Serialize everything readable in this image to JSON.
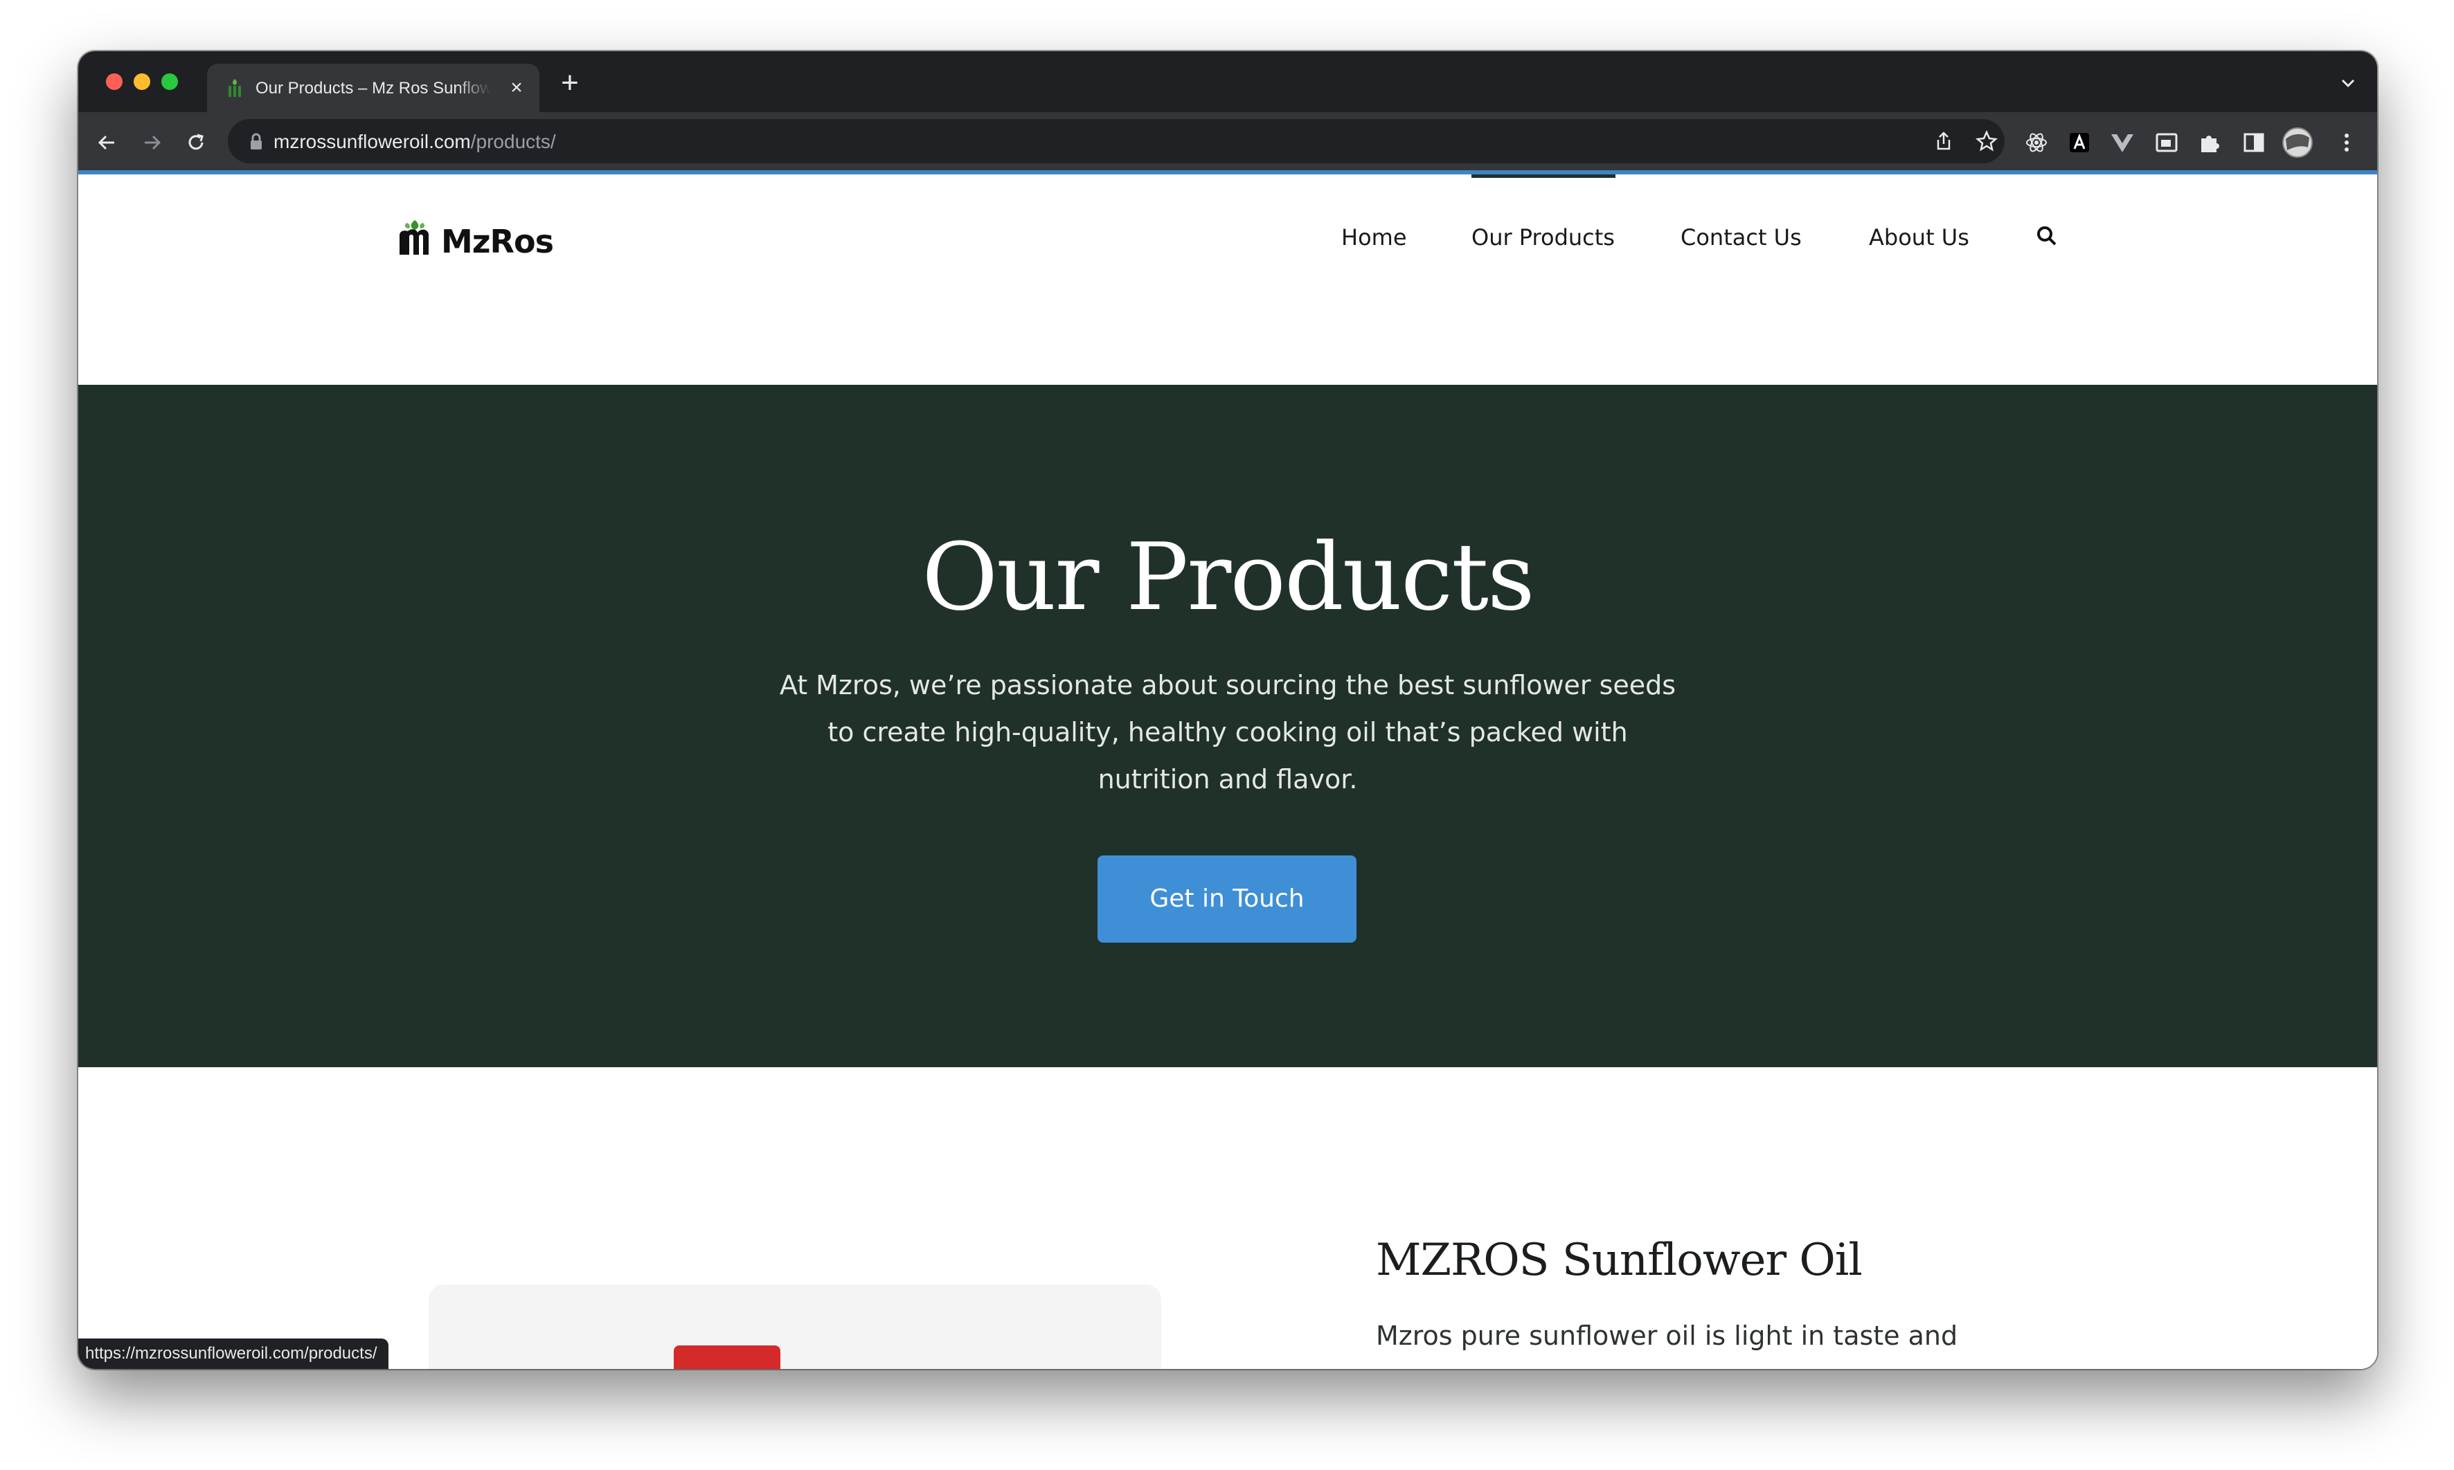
{
  "browser": {
    "tab_title": "Our Products – Mz Ros Sunflower Oil",
    "url_host": "mzrossunfloweroil.com",
    "url_path": "/products/",
    "status_url": "https://mzrossunfloweroil.com/products/"
  },
  "site": {
    "logo_text": "MzRos",
    "nav": {
      "home": "Home",
      "products": "Our Products",
      "contact": "Contact Us",
      "about": "About Us"
    }
  },
  "hero": {
    "title": "Our Products",
    "text": "At Mzros, we’re passionate about sourcing the best sunflower seeds to create high-quality, healthy cooking oil that’s packed with nutrition and flavor.",
    "button": "Get in Touch"
  },
  "product": {
    "title": "MZROS Sunflower Oil",
    "description": "Mzros pure sunflower oil is light in taste and appearance and supplies more Vitamin E"
  },
  "colors": {
    "hero_bg": "#203129",
    "button_bg": "#3f8fd6",
    "brand_green": "#3a8f2b"
  }
}
